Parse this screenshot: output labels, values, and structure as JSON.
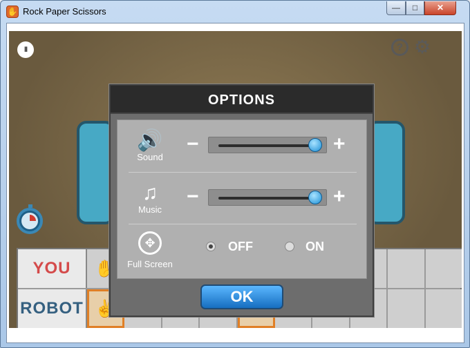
{
  "window": {
    "title": "Rock Paper Scissors",
    "minimize": "—",
    "maximize": "□",
    "close": "✕",
    "app_icon": "✋"
  },
  "game": {
    "pause_icon": "II",
    "help_icon": "?",
    "settings_icon": "⚙",
    "scoreboard": {
      "you_label": "YOU",
      "robot_label": "ROBOT",
      "you_cells": [
        "✋",
        "",
        "",
        "",
        "",
        "",
        "",
        "",
        "",
        ""
      ],
      "robot_cells": [
        "✌",
        "✌",
        "✊",
        "✊",
        "✊",
        "✌",
        "",
        "",
        "",
        ""
      ]
    }
  },
  "options": {
    "title": "OPTIONS",
    "sound": {
      "label": "Sound",
      "icon": "🔊",
      "minus": "−",
      "plus": "+",
      "volume_percent": 100
    },
    "music": {
      "label": "Music",
      "icon": "♫",
      "minus": "−",
      "plus": "+",
      "volume_percent": 100
    },
    "fullscreen": {
      "label": "Full Screen",
      "off": "OFF",
      "on": "ON",
      "selected": "OFF",
      "icon": "✥"
    },
    "ok": "OK"
  }
}
